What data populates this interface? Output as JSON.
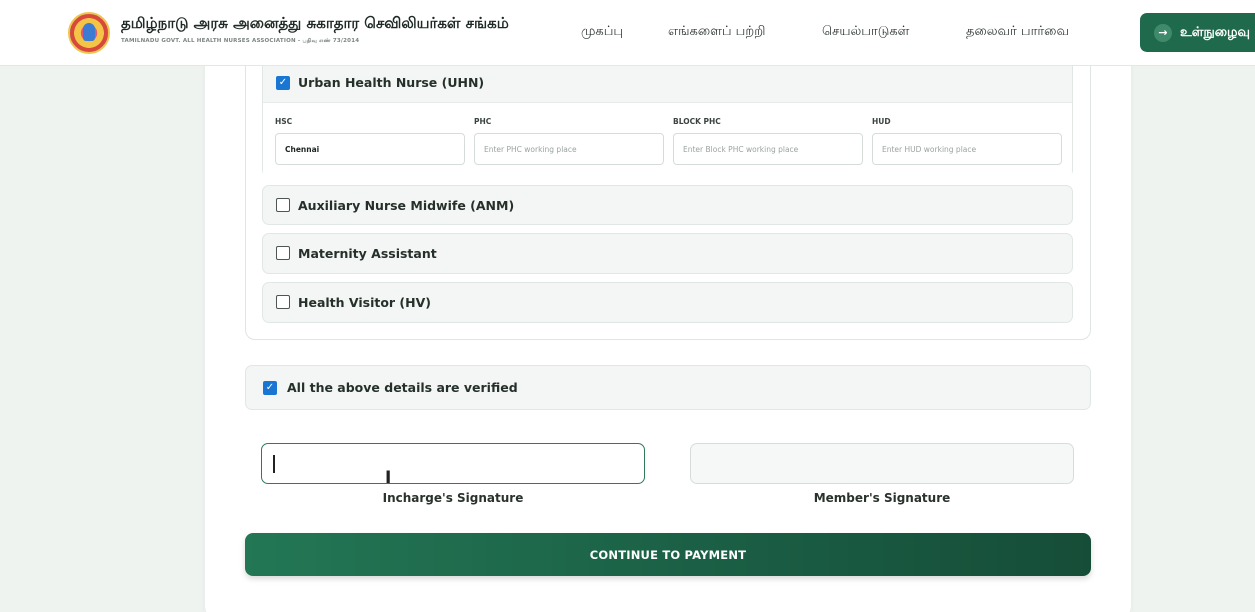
{
  "header": {
    "title": "தமிழ்நாடு அரசு அனைத்து சுகாதார செவிலியர்கள் சங்கம்",
    "subtitle": "TAMILNADU GOVT. ALL HEALTH NURSES ASSOCIATION - பதிவு எண் 73/2014",
    "nav": [
      "முகப்பு",
      "எங்களைப் பற்றி",
      "செயல்பாடுகள்",
      "தலைவர் பார்வை"
    ],
    "login_label": "உள்நுழைவு",
    "login_icon": "arrow-right-icon"
  },
  "options": {
    "uhn": {
      "label": "Urban Health Nurse (UHN)",
      "checked": true
    },
    "anm": {
      "label": "Auxiliary Nurse Midwife (ANM)",
      "checked": false
    },
    "ma": {
      "label": "Maternity Assistant",
      "checked": false
    },
    "hv": {
      "label": "Health Visitor (HV)",
      "checked": false
    }
  },
  "uhn_fields": {
    "hsc": {
      "label": "HSC",
      "value": "Chennai"
    },
    "phc": {
      "label": "PHC",
      "placeholder": "Enter PHC working place"
    },
    "block_phc": {
      "label": "BLOCK PHC",
      "placeholder": "Enter Block PHC working place"
    },
    "hud": {
      "label": "HUD",
      "placeholder": "Enter HUD working place"
    }
  },
  "verify": {
    "label": "All the above details are verified",
    "checked": true
  },
  "signatures": {
    "incharge_label": "Incharge's Signature",
    "incharge_value": "",
    "member_label": "Member's Signature",
    "member_value": ""
  },
  "continue_label": "CONTINUE TO PAYMENT",
  "colors": {
    "brand_green": "#1f6a4c",
    "checkbox_blue": "#1976d2",
    "page_bg": "#eef3ef"
  }
}
